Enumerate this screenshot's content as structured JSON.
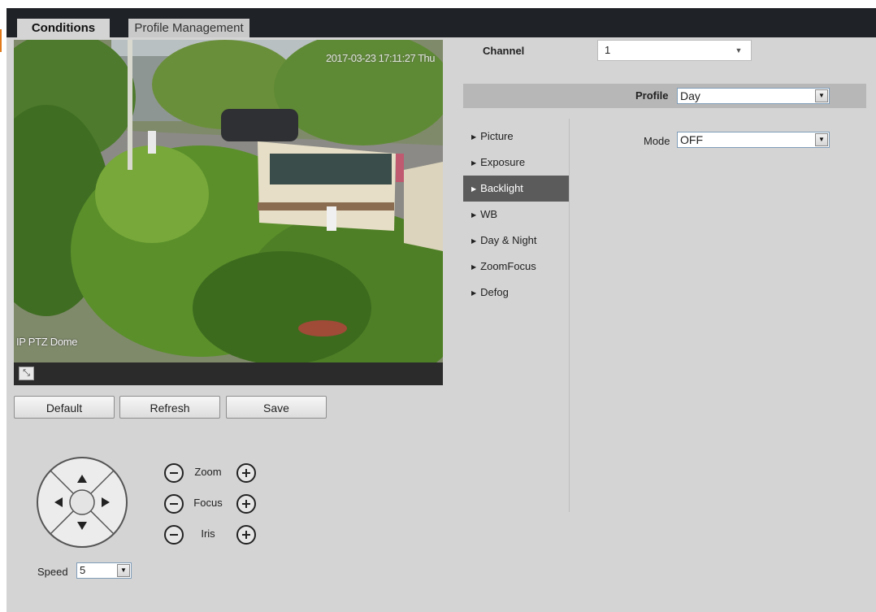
{
  "tabs": [
    {
      "label": "Conditions",
      "active": true
    },
    {
      "label": "Profile Management",
      "active": false
    }
  ],
  "video": {
    "timestamp": "2017-03-23 17:11:27 Thu",
    "camera_name": "IP PTZ Dome"
  },
  "buttons": {
    "default": "Default",
    "refresh": "Refresh",
    "save": "Save"
  },
  "ptz": {
    "zoom_label": "Zoom",
    "focus_label": "Focus",
    "iris_label": "Iris",
    "speed_label": "Speed",
    "speed_value": "5"
  },
  "settings": {
    "channel_label": "Channel",
    "channel_value": "1",
    "profile_label": "Profile",
    "profile_value": "Day",
    "mode_label": "Mode",
    "mode_value": "OFF"
  },
  "menu": [
    {
      "label": "Picture",
      "active": false
    },
    {
      "label": "Exposure",
      "active": false
    },
    {
      "label": "Backlight",
      "active": true
    },
    {
      "label": "WB",
      "active": false
    },
    {
      "label": "Day & Night",
      "active": false
    },
    {
      "label": "ZoomFocus",
      "active": false
    },
    {
      "label": "Defog",
      "active": false
    }
  ],
  "colors": {
    "panel_bg": "#d4d4d4",
    "tabbar_bg": "#1f2227",
    "menu_active_bg": "#5b5b5b",
    "profile_bar_bg": "#b7b7b7",
    "accent": "#e07a1a"
  }
}
